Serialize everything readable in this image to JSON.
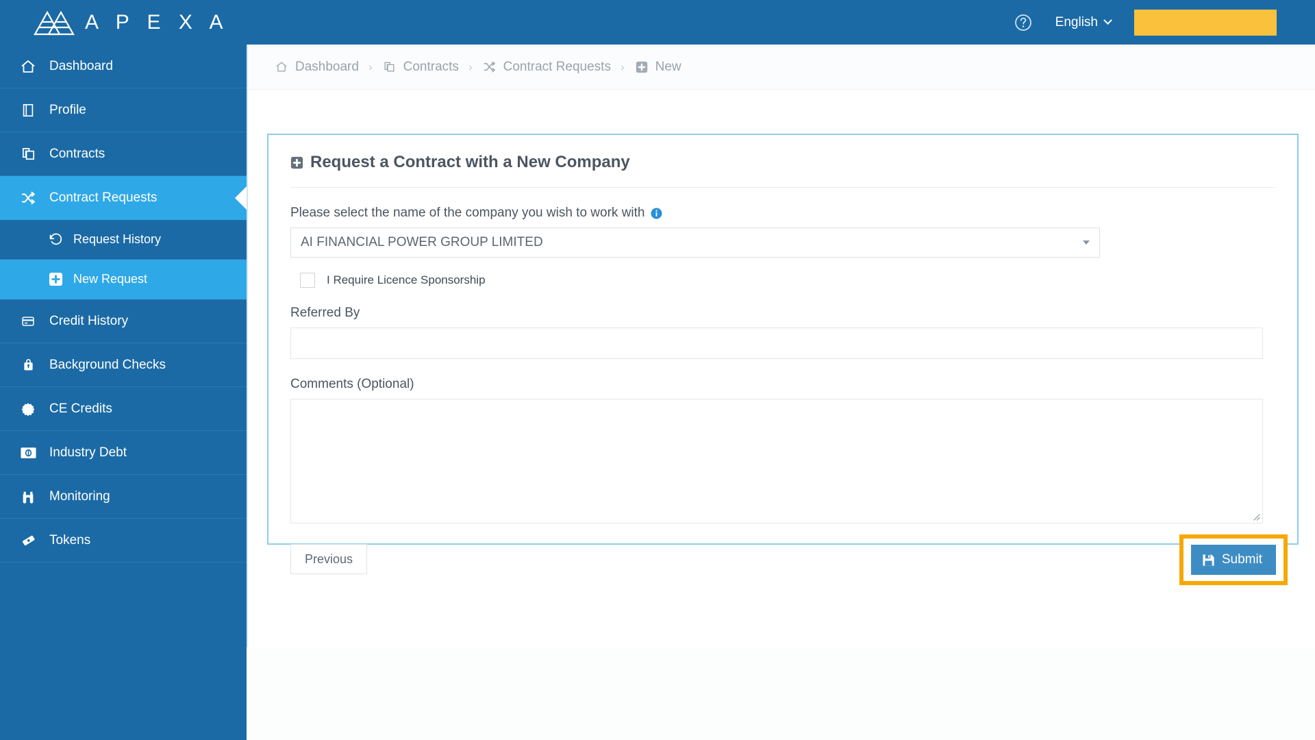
{
  "header": {
    "brand": "A P E X A",
    "logo_icon": "apexa-triangle-logo",
    "help_icon": "help-circle-icon",
    "language": "English",
    "language_caret_icon": "chevron-down-icon",
    "user_chip": ""
  },
  "sidebar": {
    "items": [
      {
        "label": "Dashboard",
        "icon": "home-icon",
        "active": false,
        "sub": false
      },
      {
        "label": "Profile",
        "icon": "book-icon",
        "active": false,
        "sub": false
      },
      {
        "label": "Contracts",
        "icon": "copy-icon",
        "active": false,
        "sub": false
      },
      {
        "label": "Contract Requests",
        "icon": "shuffle-icon",
        "active": true,
        "sub": false
      },
      {
        "label": "Request History",
        "icon": "history-icon",
        "active": false,
        "sub": true
      },
      {
        "label": "New Request",
        "icon": "plus-square-icon",
        "active": true,
        "sub": true
      },
      {
        "label": "Credit History",
        "icon": "credit-card-icon",
        "active": false,
        "sub": false
      },
      {
        "label": "Background Checks",
        "icon": "lock-bag-icon",
        "active": false,
        "sub": false
      },
      {
        "label": "CE Credits",
        "icon": "badge-icon",
        "active": false,
        "sub": false
      },
      {
        "label": "Industry Debt",
        "icon": "money-icon",
        "active": false,
        "sub": false
      },
      {
        "label": "Monitoring",
        "icon": "binoculars-icon",
        "active": false,
        "sub": false
      },
      {
        "label": "Tokens",
        "icon": "ticket-icon",
        "active": false,
        "sub": false
      }
    ]
  },
  "breadcrumb": {
    "items": [
      {
        "label": "Dashboard",
        "icon": "home-icon"
      },
      {
        "label": "Contracts",
        "icon": "copy-icon"
      },
      {
        "label": "Contract Requests",
        "icon": "shuffle-icon"
      },
      {
        "label": "New",
        "icon": "plus-square-icon"
      }
    ],
    "separator": "›"
  },
  "panel": {
    "title": "Request a Contract with a New Company",
    "title_icon": "plus-square-icon",
    "company_label": "Please select the name of the company you wish to work with",
    "company_info_icon": "info-circle-icon",
    "company_value": "AI FINANCIAL POWER GROUP LIMITED",
    "company_caret_icon": "caret-down-icon",
    "sponsorship_label": "I Require Licence Sponsorship",
    "sponsorship_checked": false,
    "referred_by_label": "Referred By",
    "referred_by_value": "",
    "referred_by_placeholder": "",
    "comments_label": "Comments (Optional)",
    "comments_value": "",
    "comments_placeholder": "",
    "previous_label": "Previous",
    "submit_label": "Submit",
    "submit_icon": "save-icon"
  },
  "colors": {
    "brand_blue": "#1b6aa5",
    "active_blue": "#2fa8e8",
    "submit_blue": "#3d8dc4",
    "highlight_orange": "#f5a800",
    "chip_yellow": "#fac13c",
    "panel_border": "#8dcdea"
  }
}
